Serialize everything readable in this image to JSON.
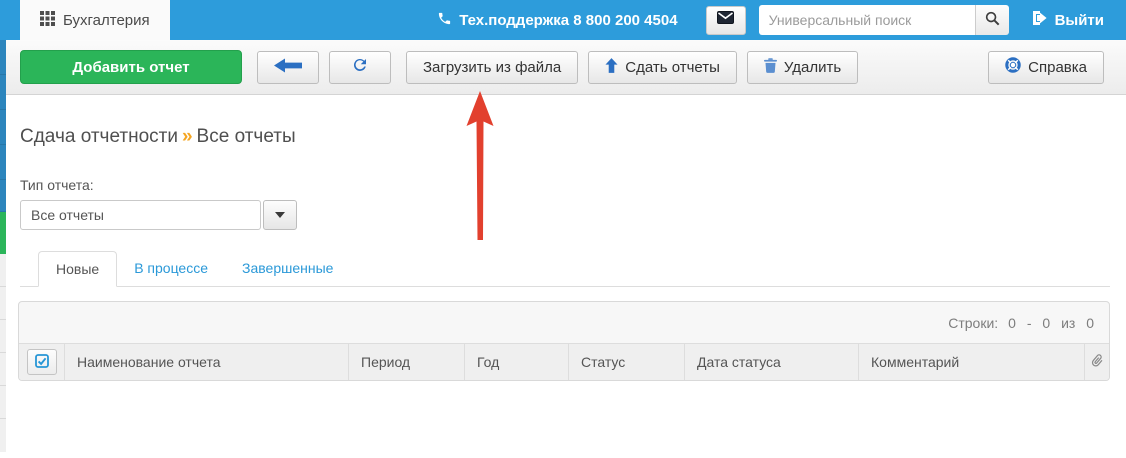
{
  "header": {
    "app_tab": "Бухгалтерия",
    "support_phone": "Тех.поддержка 8 800 200 4504",
    "search_placeholder": "Универсальный поиск",
    "logout": "Выйти"
  },
  "toolbar": {
    "add_report": "Добавить отчет",
    "load_from_file": "Загрузить из файла",
    "submit_reports": "Сдать отчеты",
    "delete": "Удалить",
    "help": "Справка"
  },
  "breadcrumb": {
    "section": "Сдача отчетности",
    "separator": "»",
    "current": "Все отчеты"
  },
  "filter": {
    "label": "Тип отчета:",
    "selected": "Все отчеты"
  },
  "tabs": [
    {
      "label": "Новые",
      "active": true
    },
    {
      "label": "В процессе",
      "active": false
    },
    {
      "label": "Завершенные",
      "active": false
    }
  ],
  "table": {
    "rows_counter_label": "Строки:",
    "rows_counter_value": "0 - 0 из 0",
    "columns": [
      "Наименование отчета",
      "Период",
      "Год",
      "Статус",
      "Дата статуса",
      "Комментарий"
    ],
    "rows": []
  },
  "colors": {
    "header_blue": "#2d9cdb",
    "link_blue": "#2b99d8",
    "icon_blue": "#2b6fc2",
    "accent_green": "#2bb559",
    "breadcrumb_orange": "#f5a623",
    "annotation_red": "#e2402e"
  }
}
